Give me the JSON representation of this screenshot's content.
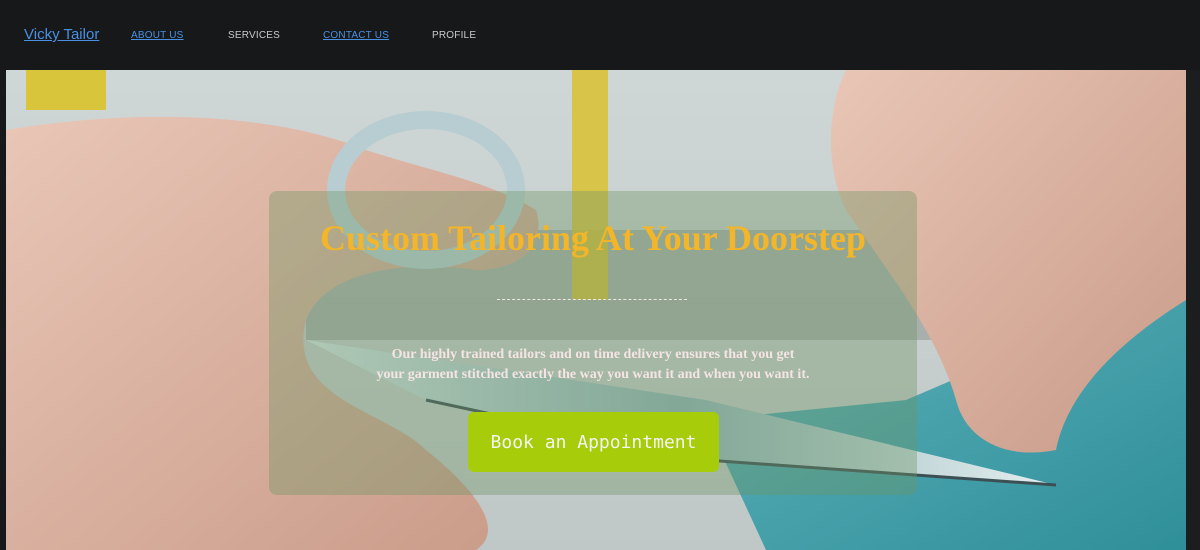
{
  "nav": {
    "brand": "Vicky Tailor",
    "links": [
      {
        "label": "ABOUT US",
        "style": "link"
      },
      {
        "label": "SERVICES",
        "style": "plain"
      },
      {
        "label": "CONTACT US",
        "style": "link"
      },
      {
        "label": "PROFILE",
        "style": "plain"
      }
    ]
  },
  "hero": {
    "image": "tailor-scissors-cutting-fabric-photo",
    "headline": "Custom Tailoring At Your Doorstep",
    "divider": "----------------",
    "tagline_line1": "Our highly trained tailors and on time delivery ensures that you get",
    "tagline_line2": "your garment stitched exactly the way you want it and when you want it.",
    "cta_label": "Book an Appointment"
  },
  "colors": {
    "nav_bg": "#17181a",
    "link": "#4a90e2",
    "headline": "#f3b52a",
    "cta_bg": "#a6cc0a"
  }
}
